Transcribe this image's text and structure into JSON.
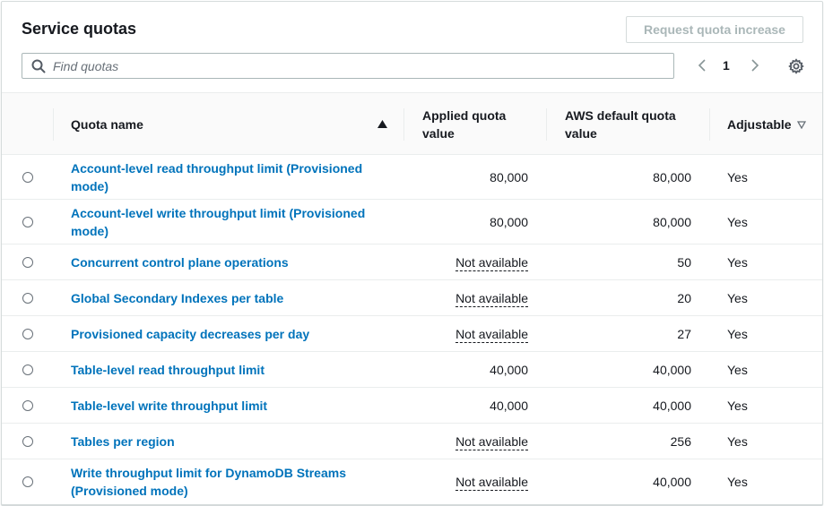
{
  "header": {
    "title": "Service quotas",
    "request_button": "Request quota increase"
  },
  "search": {
    "placeholder": "Find quotas",
    "value": ""
  },
  "pagination": {
    "current_page": "1"
  },
  "columns": {
    "quota_name": "Quota name",
    "applied": "Applied quota value",
    "aws_default": "AWS default quota value",
    "adjustable": "Adjustable"
  },
  "rows": [
    {
      "name": "Account-level read throughput limit (Provisioned mode)",
      "applied": "80,000",
      "default": "80,000",
      "adjustable": "Yes"
    },
    {
      "name": "Account-level write throughput limit (Provisioned mode)",
      "applied": "80,000",
      "default": "80,000",
      "adjustable": "Yes"
    },
    {
      "name": "Concurrent control plane operations",
      "applied": "Not available",
      "default": "50",
      "adjustable": "Yes"
    },
    {
      "name": "Global Secondary Indexes per table",
      "applied": "Not available",
      "default": "20",
      "adjustable": "Yes"
    },
    {
      "name": "Provisioned capacity decreases per day",
      "applied": "Not available",
      "default": "27",
      "adjustable": "Yes"
    },
    {
      "name": "Table-level read throughput limit",
      "applied": "40,000",
      "default": "40,000",
      "adjustable": "Yes"
    },
    {
      "name": "Table-level write throughput limit",
      "applied": "40,000",
      "default": "40,000",
      "adjustable": "Yes"
    },
    {
      "name": "Tables per region",
      "applied": "Not available",
      "default": "256",
      "adjustable": "Yes"
    },
    {
      "name": "Write throughput limit for DynamoDB Streams (Provisioned mode)",
      "applied": "Not available",
      "default": "40,000",
      "adjustable": "Yes"
    }
  ],
  "colors": {
    "link": "#0073bb",
    "text": "#16191f",
    "border": "#eaeded",
    "disabled": "#aab7b8"
  },
  "icons": {
    "search": "search-icon",
    "prev": "chevron-left-icon",
    "next": "chevron-right-icon",
    "settings": "gear-icon",
    "sort": "sort-ascending-icon",
    "filter": "sort-descending-outline-icon"
  }
}
